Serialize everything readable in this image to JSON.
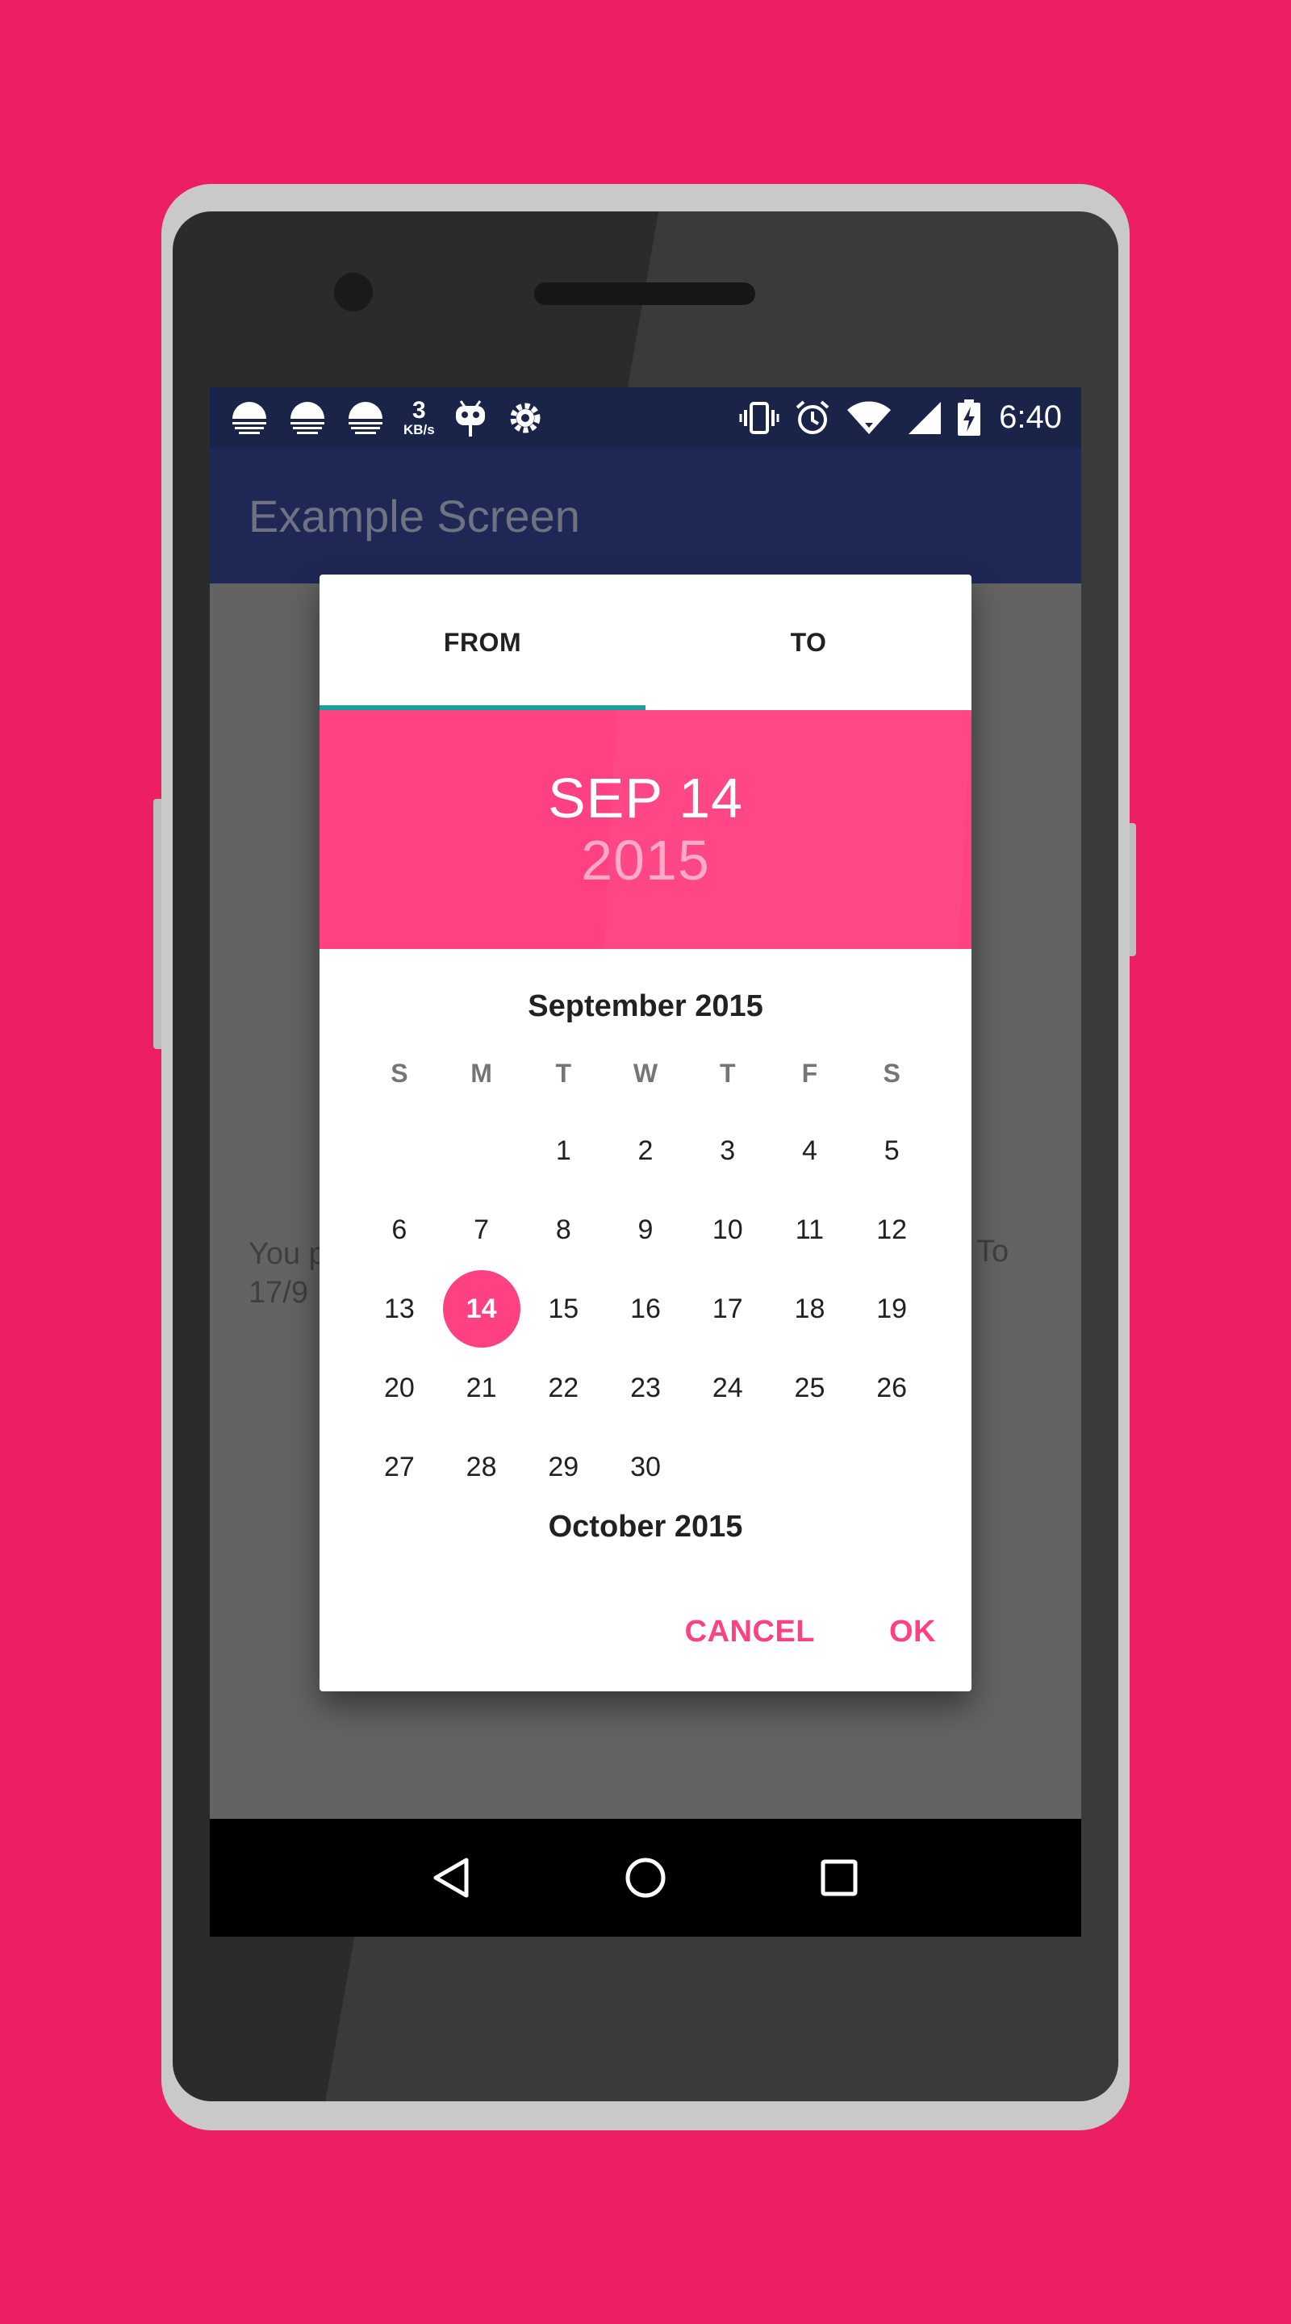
{
  "status_bar": {
    "speed_value": "3",
    "speed_unit": "KB/s",
    "time": "6:40",
    "icons_left": [
      "sunrise-icon",
      "sunrise-icon",
      "sunrise-icon",
      "android-debug-icon",
      "settings-gear-icon"
    ],
    "icons_right": [
      "vibrate-icon",
      "alarm-icon",
      "wifi-icon",
      "signal-icon",
      "battery-charging-icon"
    ]
  },
  "app_bar": {
    "title": "Example Screen"
  },
  "background_text": {
    "line1": "You p",
    "line2": "17/9",
    "right": "To"
  },
  "dialog": {
    "tabs": [
      {
        "label": "FROM",
        "active": true
      },
      {
        "label": "TO",
        "active": false
      }
    ],
    "header": {
      "date": "SEP 14",
      "year": "2015"
    },
    "month_title": "September 2015",
    "weekdays": [
      "S",
      "M",
      "T",
      "W",
      "T",
      "F",
      "S"
    ],
    "weeks": [
      [
        "",
        "",
        "1",
        "2",
        "3",
        "4",
        "5"
      ],
      [
        "6",
        "7",
        "8",
        "9",
        "10",
        "11",
        "12"
      ],
      [
        "13",
        "14",
        "15",
        "16",
        "17",
        "18",
        "19"
      ],
      [
        "20",
        "21",
        "22",
        "23",
        "24",
        "25",
        "26"
      ],
      [
        "27",
        "28",
        "29",
        "30",
        "",
        "",
        ""
      ]
    ],
    "selected_day": "14",
    "next_month_title": "October 2015",
    "actions": {
      "cancel": "CANCEL",
      "ok": "OK"
    }
  },
  "colors": {
    "background": "#EC1F63",
    "accent": "#FF4081",
    "tab_indicator": "#1AA09A",
    "status_bar": "#1A2348",
    "app_bar": "#1F2855"
  }
}
